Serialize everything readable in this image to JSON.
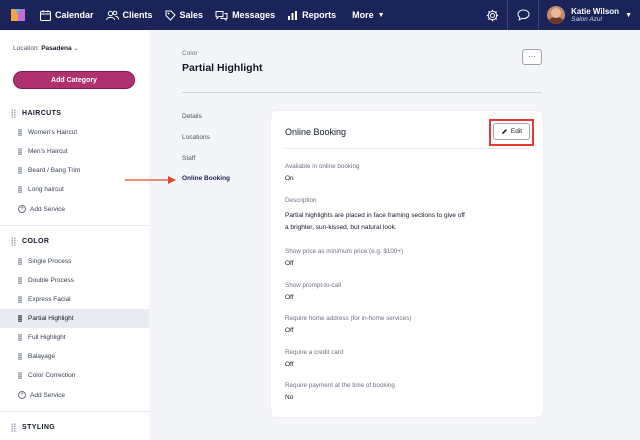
{
  "topbar": {
    "nav": [
      {
        "label": "Calendar",
        "icon": "calendar-icon"
      },
      {
        "label": "Clients",
        "icon": "clients-icon"
      },
      {
        "label": "Sales",
        "icon": "tag-icon"
      },
      {
        "label": "Messages",
        "icon": "messages-icon"
      },
      {
        "label": "Reports",
        "icon": "reports-icon"
      },
      {
        "label": "More",
        "icon": "chevron-down-icon"
      }
    ],
    "user": {
      "name": "Katie Wilson",
      "business": "Salon Azul"
    },
    "colors": {
      "bar": "#1b2459",
      "accent": "#b0316f"
    }
  },
  "sidebar": {
    "location_label": "Location:",
    "location_value": "Pasadena",
    "add_category": "Add Category",
    "categories": [
      {
        "name": "HAIRCUTS",
        "services": [
          "Women's Haircut",
          "Men's Haircut",
          "Beard / Bang Trim",
          "Long haircut"
        ],
        "add": "Add Service"
      },
      {
        "name": "COLOR",
        "services": [
          "Single Process",
          "Double Process",
          "Express Facial",
          "Partial Highlight",
          "Full Highlight",
          "Balayage",
          "Color Correction"
        ],
        "add": "Add Service"
      },
      {
        "name": "STYLING"
      }
    ],
    "active_service": "Partial Highlight"
  },
  "main": {
    "breadcrumb": "Color",
    "title": "Partial Highlight",
    "more_label": "···",
    "tabs": [
      "Details",
      "Locations",
      "Staff",
      "Online Booking"
    ],
    "active_tab": "Online Booking",
    "card": {
      "title": "Online Booking",
      "edit_label": "Edit",
      "fields": [
        {
          "label": "Available in online booking",
          "value": "On"
        },
        {
          "label": "Description",
          "value_lines": [
            "Partial highlights are placed in face framing sections to give off",
            "a brighter, sun-kissed, but natural look."
          ]
        },
        {
          "label": "Show price as minimum price (e.g. $100+)",
          "value": "Off"
        },
        {
          "label": "Show prompt-to-call",
          "value": "Off"
        },
        {
          "label": "Require home address (for in-home services)",
          "value": "Off"
        },
        {
          "label": "Require a credit card",
          "value": "Off"
        },
        {
          "label": "Require payment at the time of booking",
          "value": "No"
        }
      ]
    }
  }
}
